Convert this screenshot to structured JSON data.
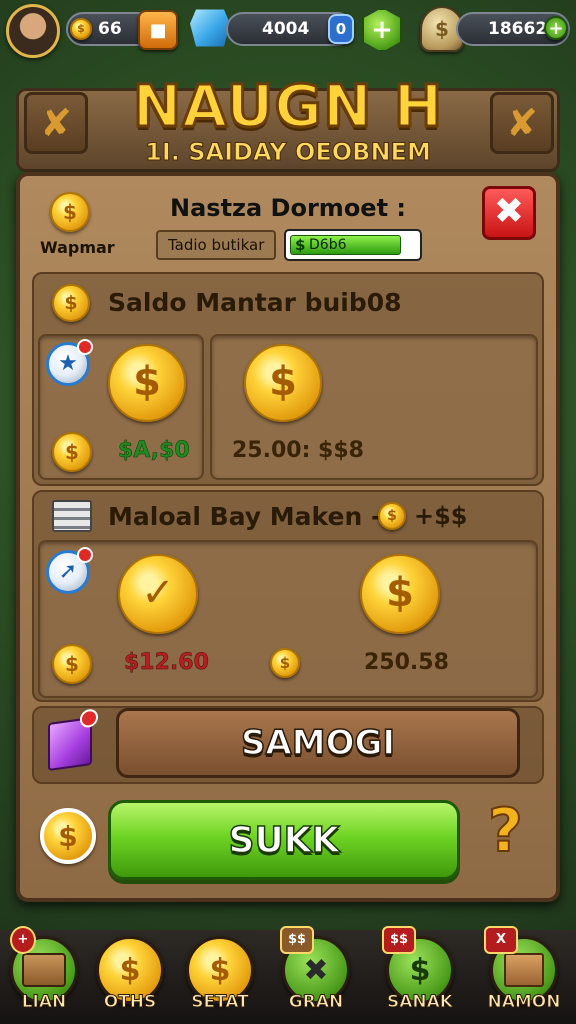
{
  "colors": {
    "accent_gold": "#ffd23a",
    "panel_wood": "#b08a5e",
    "green_button": "#6fd424",
    "close_red": "#e02020",
    "value_green": "#1f8a1f",
    "value_red": "#b32020"
  },
  "hud": {
    "coins": "66",
    "gems": "4004",
    "gem_badge": "0",
    "trophies": "18662"
  },
  "banner": {
    "title": "NAUGN H",
    "subtitle": "1I. SAIDAY OEOBNEM"
  },
  "header": {
    "name_label": "Nastza Dormoet :",
    "left_caption": "Wapmar",
    "field_label": "Tadio butikar",
    "progress_value": "D6b6",
    "progress_fraction": 0.85
  },
  "section1": {
    "title": "Saldo Mantar buib08",
    "value_left": "$A,$0",
    "value_right": "25.00: $$8"
  },
  "section2": {
    "title": "Maloal Bay Maken -",
    "title_suffix": "+$$",
    "value_left": "$12.60",
    "value_right": "250.58"
  },
  "buttons": {
    "secondary_label": "SAMOGI",
    "primary_label": "SUKK",
    "help_label": "?"
  },
  "nav": [
    {
      "label": "LIAN",
      "icon": "chest-icon",
      "tag": "+"
    },
    {
      "label": "OTHS",
      "icon": "coin-icon",
      "tag": ""
    },
    {
      "label": "SETAT",
      "icon": "coin-icon",
      "tag": ""
    },
    {
      "label": "GRAN",
      "icon": "hammer-icon",
      "tag": "$$"
    },
    {
      "label": "SANAK",
      "icon": "coin-icon",
      "tag": "$$"
    },
    {
      "label": "NAMON",
      "icon": "crate-icon",
      "tag": "X"
    }
  ]
}
